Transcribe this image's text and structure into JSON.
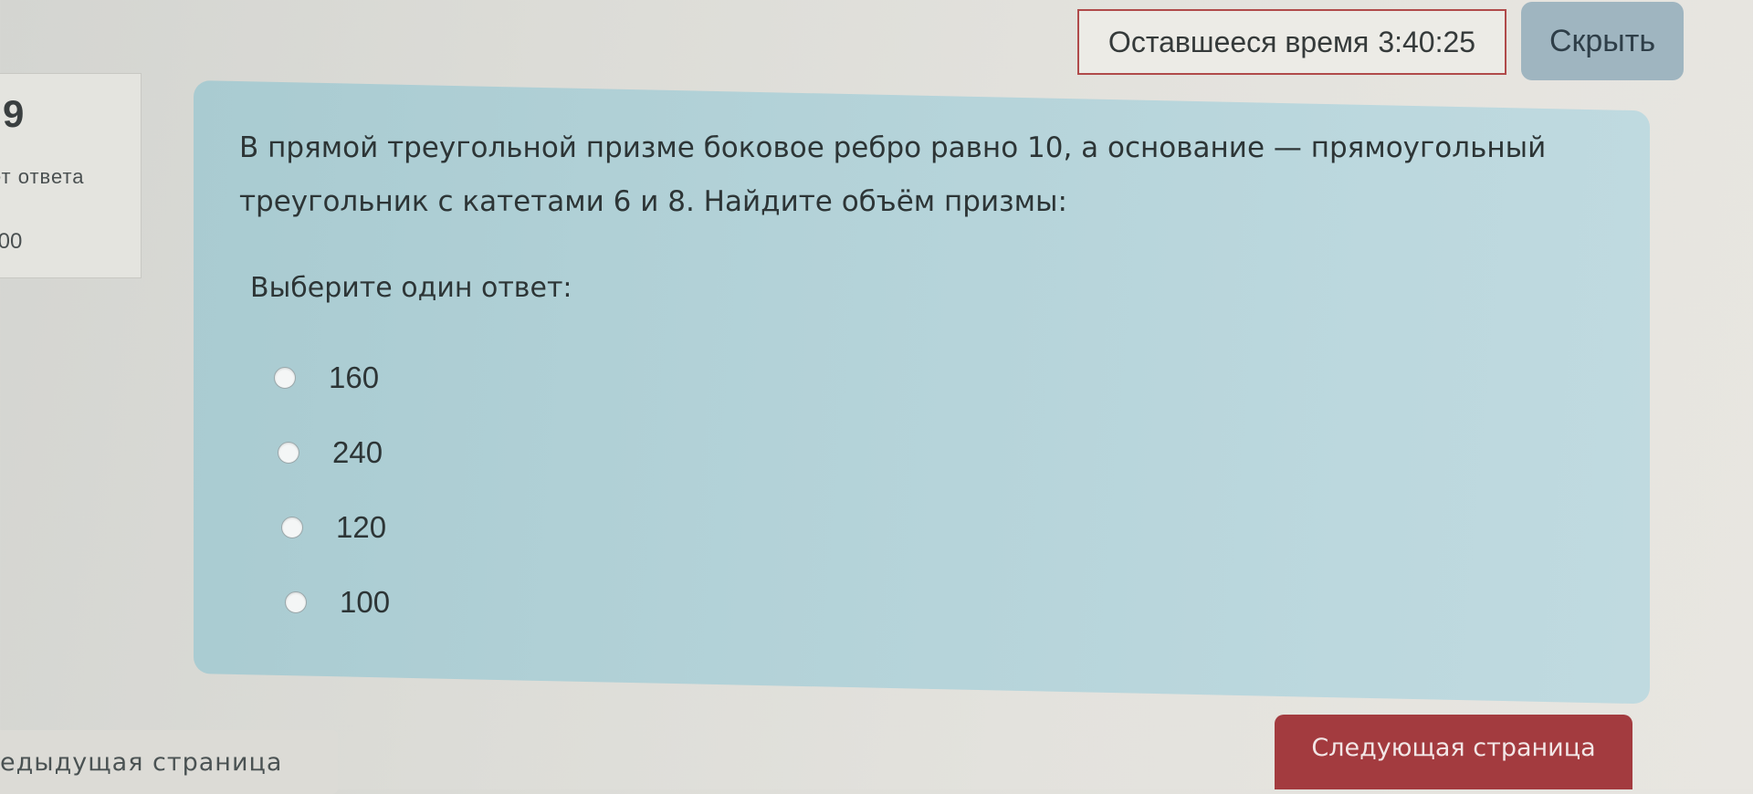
{
  "timer": {
    "label": "Оставшееся время",
    "value": "3:40:25"
  },
  "hide_button": {
    "label": "Скрыть"
  },
  "question_info": {
    "number": "9",
    "status": "ет ответа",
    "grade": ",00"
  },
  "question": {
    "text_line1": "В прямой треугольной призме боковое ребро равно 10, а основание — прямоугольный",
    "text_line2": "треугольник с катетами 6 и 8. Найдите объём призмы:",
    "prompt": "Выберите один ответ:",
    "options": [
      {
        "label": "160"
      },
      {
        "label": "240"
      },
      {
        "label": "120"
      },
      {
        "label": "100"
      }
    ]
  },
  "navigation": {
    "prev_label": "едыдущая страница",
    "next_label": "Следующая страница"
  },
  "colors": {
    "panel_bg": "#b3d2d8",
    "next_button": "#a33b3f",
    "hide_button": "#9fb5c0",
    "timer_border": "#b04a4a"
  }
}
